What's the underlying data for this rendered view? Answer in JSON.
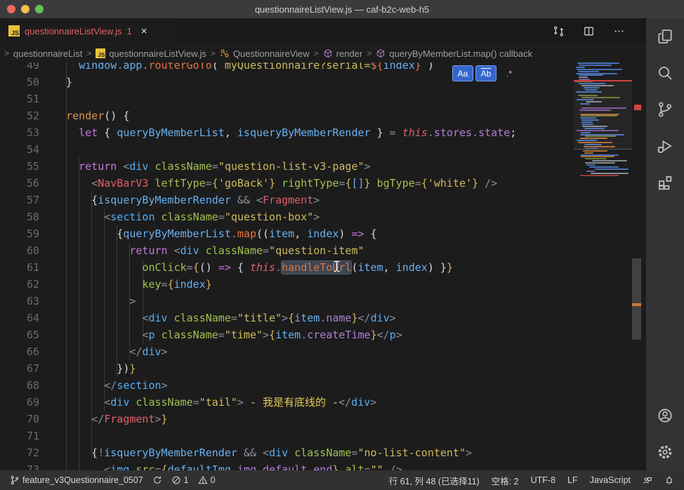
{
  "window": {
    "title": "questionnaireListView.js — caf-b2c-web-h5"
  },
  "tab_bar": {
    "tab": {
      "file_type": "JS",
      "name": "questionnaireListView.js",
      "error_badge": "1",
      "close_glyph": "×"
    },
    "actions": [
      {
        "name": "open-changes-icon"
      },
      {
        "name": "split-editor-icon"
      },
      {
        "name": "more-actions-icon"
      }
    ]
  },
  "breadcrumbs": {
    "separator": ">",
    "items": [
      {
        "label": "questionnaireList",
        "icon": ""
      },
      {
        "label": "questionnaireListView.js",
        "icon": "js-file-icon"
      },
      {
        "label": "QuestionnaireView",
        "icon": "symbol-class-icon"
      },
      {
        "label": "render",
        "icon": "symbol-method-icon"
      },
      {
        "label": "queryByMemberList.map() callback",
        "icon": "symbol-method-icon"
      }
    ]
  },
  "find_options": [
    {
      "label": "Aa",
      "name": "match-case-option",
      "selected": true,
      "whole_word": false
    },
    {
      "label": "Ab",
      "name": "whole-word-option",
      "selected": true,
      "whole_word": true
    },
    {
      "label": ".*",
      "name": "regex-option",
      "selected": false,
      "whole_word": false
    }
  ],
  "editor": {
    "token_colors": {
      "plain": "#d6d8dc",
      "pun": "#8a9098",
      "tag": "#58aef2",
      "cmp": "#e25f6b",
      "kw": "#c678dd",
      "fn": "#dc9552",
      "call": "#e0743f",
      "var": "#68b0ef",
      "attr": "#a2c04e",
      "str": "#cebc5e",
      "jsx": "#e6cc52",
      "this": "#e0626e",
      "prop": "#b07fd6",
      "b1": "#d9b45b",
      "b3": "#6fa8e8"
    },
    "selection": {
      "text": "handleToUrl",
      "line": 61,
      "chars_selected": 11
    },
    "lines": [
      {
        "n": 49,
        "segs": [
          [
            "plain",
            "    "
          ],
          [
            "var",
            "window"
          ],
          [
            "pun",
            "."
          ],
          [
            "var",
            "app"
          ],
          [
            "pun",
            "."
          ],
          [
            "call",
            "routerGoTo"
          ],
          [
            "plain",
            "("
          ],
          [
            "str",
            "`myQuestionnaire?serial="
          ],
          [
            "call",
            "${"
          ],
          [
            "var",
            "index"
          ],
          [
            "call",
            "}"
          ],
          [
            "str",
            "`"
          ],
          [
            "plain",
            ")"
          ]
        ]
      },
      {
        "n": 50,
        "segs": [
          [
            "plain",
            "  }"
          ]
        ]
      },
      {
        "n": 51,
        "segs": []
      },
      {
        "n": 52,
        "segs": [
          [
            "plain",
            "  "
          ],
          [
            "fn",
            "render"
          ],
          [
            "plain",
            "() {"
          ]
        ]
      },
      {
        "n": 53,
        "segs": [
          [
            "plain",
            "    "
          ],
          [
            "kw",
            "let"
          ],
          [
            "plain",
            " { "
          ],
          [
            "var",
            "queryByMemberList"
          ],
          [
            "plain",
            ", "
          ],
          [
            "var",
            "isqueryByMemberRender"
          ],
          [
            "plain",
            " } "
          ],
          [
            "pun",
            "="
          ],
          [
            "plain",
            " "
          ],
          [
            "this",
            "this",
            "it"
          ],
          [
            "pun",
            "."
          ],
          [
            "prop",
            "stores"
          ],
          [
            "pun",
            "."
          ],
          [
            "prop",
            "state"
          ],
          [
            "plain",
            ";"
          ]
        ]
      },
      {
        "n": 54,
        "segs": []
      },
      {
        "n": 55,
        "segs": [
          [
            "plain",
            "    "
          ],
          [
            "kw",
            "return"
          ],
          [
            "plain",
            " "
          ],
          [
            "pun",
            "<"
          ],
          [
            "tag",
            "div"
          ],
          [
            "plain",
            " "
          ],
          [
            "attr",
            "className"
          ],
          [
            "pun",
            "="
          ],
          [
            "str",
            "\"question-list-v3-page\""
          ],
          [
            "pun",
            ">"
          ]
        ]
      },
      {
        "n": 56,
        "segs": [
          [
            "plain",
            "      "
          ],
          [
            "pun",
            "<"
          ],
          [
            "cmp",
            "NavBarV3"
          ],
          [
            "plain",
            " "
          ],
          [
            "attr",
            "leftType"
          ],
          [
            "pun",
            "="
          ],
          [
            "b1",
            "{"
          ],
          [
            "str",
            "'goBack'"
          ],
          [
            "b1",
            "}"
          ],
          [
            "plain",
            " "
          ],
          [
            "attr",
            "rightType"
          ],
          [
            "pun",
            "="
          ],
          [
            "b1",
            "{"
          ],
          [
            "b3",
            "[]"
          ],
          [
            "b1",
            "}"
          ],
          [
            "plain",
            " "
          ],
          [
            "attr",
            "bgType"
          ],
          [
            "pun",
            "="
          ],
          [
            "b1",
            "{"
          ],
          [
            "str",
            "'white'"
          ],
          [
            "b1",
            "}"
          ],
          [
            "plain",
            " "
          ],
          [
            "pun",
            "/>"
          ]
        ]
      },
      {
        "n": 57,
        "segs": [
          [
            "plain",
            "      {"
          ],
          [
            "var",
            "isqueryByMemberRender"
          ],
          [
            "plain",
            " "
          ],
          [
            "pun",
            "&&"
          ],
          [
            "plain",
            " "
          ],
          [
            "pun",
            "<"
          ],
          [
            "cmp",
            "Fragment"
          ],
          [
            "pun",
            ">"
          ]
        ]
      },
      {
        "n": 58,
        "segs": [
          [
            "plain",
            "        "
          ],
          [
            "pun",
            "<"
          ],
          [
            "tag",
            "section"
          ],
          [
            "plain",
            " "
          ],
          [
            "attr",
            "className"
          ],
          [
            "pun",
            "="
          ],
          [
            "str",
            "\"question-box\""
          ],
          [
            "pun",
            ">"
          ]
        ]
      },
      {
        "n": 59,
        "segs": [
          [
            "plain",
            "          {"
          ],
          [
            "var",
            "queryByMemberList"
          ],
          [
            "pun",
            "."
          ],
          [
            "call",
            "map"
          ],
          [
            "plain",
            "(("
          ],
          [
            "var",
            "item"
          ],
          [
            "plain",
            ", "
          ],
          [
            "var",
            "index"
          ],
          [
            "plain",
            ") "
          ],
          [
            "kw",
            "=>"
          ],
          [
            "plain",
            " {"
          ]
        ]
      },
      {
        "n": 60,
        "segs": [
          [
            "plain",
            "            "
          ],
          [
            "kw",
            "return"
          ],
          [
            "plain",
            " "
          ],
          [
            "pun",
            "<"
          ],
          [
            "tag",
            "div"
          ],
          [
            "plain",
            " "
          ],
          [
            "attr",
            "className"
          ],
          [
            "pun",
            "="
          ],
          [
            "str",
            "\"question-item\""
          ]
        ]
      },
      {
        "n": 61,
        "segs": [
          [
            "plain",
            "              "
          ],
          [
            "attr",
            "onClick"
          ],
          [
            "pun",
            "="
          ],
          [
            "b1",
            "{"
          ],
          [
            "plain",
            "() "
          ],
          [
            "kw",
            "=>"
          ],
          [
            "plain",
            " { "
          ],
          [
            "this",
            "this",
            "it"
          ],
          [
            "pun",
            "."
          ],
          [
            "call",
            "handleToUrl",
            "sel"
          ],
          [
            "plain",
            "("
          ],
          [
            "var",
            "item"
          ],
          [
            "plain",
            ", "
          ],
          [
            "var",
            "index"
          ],
          [
            "plain",
            ") }"
          ],
          [
            "b1",
            "}"
          ]
        ]
      },
      {
        "n": 62,
        "segs": [
          [
            "plain",
            "              "
          ],
          [
            "attr",
            "key"
          ],
          [
            "pun",
            "="
          ],
          [
            "b1",
            "{"
          ],
          [
            "var",
            "index"
          ],
          [
            "b1",
            "}"
          ]
        ]
      },
      {
        "n": 63,
        "segs": [
          [
            "plain",
            "            "
          ],
          [
            "pun",
            ">"
          ]
        ]
      },
      {
        "n": 64,
        "segs": [
          [
            "plain",
            "              "
          ],
          [
            "pun",
            "<"
          ],
          [
            "tag",
            "div"
          ],
          [
            "plain",
            " "
          ],
          [
            "attr",
            "className"
          ],
          [
            "pun",
            "="
          ],
          [
            "str",
            "\"title\""
          ],
          [
            "pun",
            ">"
          ],
          [
            "b1",
            "{"
          ],
          [
            "var",
            "item"
          ],
          [
            "pun",
            "."
          ],
          [
            "prop",
            "name"
          ],
          [
            "b1",
            "}"
          ],
          [
            "pun",
            "</"
          ],
          [
            "tag",
            "div"
          ],
          [
            "pun",
            ">"
          ]
        ]
      },
      {
        "n": 65,
        "segs": [
          [
            "plain",
            "              "
          ],
          [
            "pun",
            "<"
          ],
          [
            "tag",
            "p"
          ],
          [
            "plain",
            " "
          ],
          [
            "attr",
            "className"
          ],
          [
            "pun",
            "="
          ],
          [
            "str",
            "\"time\""
          ],
          [
            "pun",
            ">"
          ],
          [
            "b1",
            "{"
          ],
          [
            "var",
            "item"
          ],
          [
            "pun",
            "."
          ],
          [
            "prop",
            "createTime"
          ],
          [
            "b1",
            "}"
          ],
          [
            "pun",
            "</"
          ],
          [
            "tag",
            "p"
          ],
          [
            "pun",
            ">"
          ]
        ]
      },
      {
        "n": 66,
        "segs": [
          [
            "plain",
            "            "
          ],
          [
            "pun",
            "</"
          ],
          [
            "tag",
            "div"
          ],
          [
            "pun",
            ">"
          ]
        ]
      },
      {
        "n": 67,
        "segs": [
          [
            "plain",
            "          })"
          ],
          [
            "b1",
            "}"
          ]
        ]
      },
      {
        "n": 68,
        "segs": [
          [
            "plain",
            "        "
          ],
          [
            "pun",
            "</"
          ],
          [
            "tag",
            "section"
          ],
          [
            "pun",
            ">"
          ]
        ]
      },
      {
        "n": 69,
        "segs": [
          [
            "plain",
            "        "
          ],
          [
            "pun",
            "<"
          ],
          [
            "tag",
            "div"
          ],
          [
            "plain",
            " "
          ],
          [
            "attr",
            "className"
          ],
          [
            "pun",
            "="
          ],
          [
            "str",
            "\"tail\""
          ],
          [
            "pun",
            ">"
          ],
          [
            "jsx",
            " - 我是有底线的 -"
          ],
          [
            "pun",
            "</"
          ],
          [
            "tag",
            "div"
          ],
          [
            "pun",
            ">"
          ]
        ]
      },
      {
        "n": 70,
        "segs": [
          [
            "plain",
            "      "
          ],
          [
            "pun",
            "</"
          ],
          [
            "cmp",
            "Fragment"
          ],
          [
            "pun",
            ">"
          ],
          [
            "b1",
            "}"
          ]
        ]
      },
      {
        "n": 71,
        "segs": []
      },
      {
        "n": 72,
        "segs": [
          [
            "plain",
            "      {"
          ],
          [
            "pun",
            "!"
          ],
          [
            "var",
            "isqueryByMemberRender"
          ],
          [
            "plain",
            " "
          ],
          [
            "pun",
            "&&"
          ],
          [
            "plain",
            " "
          ],
          [
            "pun",
            "<"
          ],
          [
            "tag",
            "div"
          ],
          [
            "plain",
            " "
          ],
          [
            "attr",
            "className"
          ],
          [
            "pun",
            "="
          ],
          [
            "str",
            "\"no-list-content\""
          ],
          [
            "pun",
            ">"
          ]
        ]
      },
      {
        "n": 73,
        "segs": [
          [
            "plain",
            "        "
          ],
          [
            "pun",
            "<"
          ],
          [
            "tag",
            "img"
          ],
          [
            "plain",
            " "
          ],
          [
            "attr",
            "src"
          ],
          [
            "pun",
            "="
          ],
          [
            "b1",
            "{"
          ],
          [
            "var",
            "defaultImg"
          ],
          [
            "pun",
            "."
          ],
          [
            "prop",
            "img_default_end"
          ],
          [
            "b1",
            "}"
          ],
          [
            "plain",
            " "
          ],
          [
            "attr",
            "alt"
          ],
          [
            "pun",
            "="
          ],
          [
            "str",
            "\"\""
          ],
          [
            "plain",
            " "
          ],
          [
            "pun",
            "/>"
          ]
        ]
      }
    ]
  },
  "activity_bar": {
    "top": [
      {
        "name": "files-icon"
      },
      {
        "name": "search-icon"
      },
      {
        "name": "source-control-icon"
      },
      {
        "name": "run-debug-icon"
      },
      {
        "name": "extensions-icon"
      }
    ],
    "bottom": [
      {
        "name": "account-icon"
      },
      {
        "name": "settings-icon"
      }
    ]
  },
  "status_bar": {
    "left": [
      {
        "icon": "git-branch-icon",
        "label": "feature_v3Questionnaire_0507",
        "name": "git-branch-item"
      },
      {
        "icon": "sync-icon",
        "label": "",
        "name": "sync-item"
      },
      {
        "icon": "error-icon",
        "label": "1",
        "name": "errors-item"
      },
      {
        "icon": "warning-icon",
        "label": "0",
        "name": "warnings-item"
      }
    ],
    "right": [
      {
        "icon": "",
        "label": "行 61, 列 48 (已选择11)",
        "name": "cursor-position-item"
      },
      {
        "icon": "",
        "label": "空格: 2",
        "name": "indentation-item"
      },
      {
        "icon": "",
        "label": "UTF-8",
        "name": "encoding-item"
      },
      {
        "icon": "",
        "label": "LF",
        "name": "eol-item"
      },
      {
        "icon": "",
        "label": "JavaScript",
        "name": "language-mode-item"
      },
      {
        "icon": "feedback-icon",
        "label": "",
        "name": "feedback-item"
      },
      {
        "icon": "bell-icon",
        "label": "",
        "name": "notifications-item"
      }
    ]
  }
}
